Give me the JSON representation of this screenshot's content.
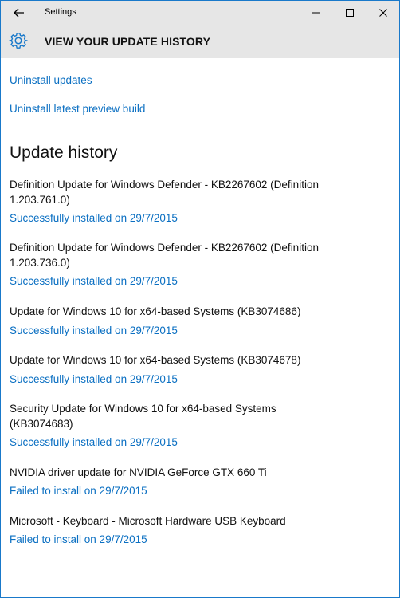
{
  "window": {
    "app_title": "Settings",
    "accent_color": "#1979ca",
    "controls": {
      "back": "back-arrow-icon",
      "minimize": "minimize-icon",
      "maximize": "maximize-icon",
      "close": "close-icon"
    }
  },
  "header": {
    "icon": "gear-icon",
    "title": "VIEW YOUR UPDATE HISTORY"
  },
  "links": {
    "uninstall_updates": "Uninstall updates",
    "uninstall_preview": "Uninstall latest preview build"
  },
  "history": {
    "title": "Update history",
    "entries": [
      {
        "title": "Definition Update for Windows Defender - KB2267602 (Definition 1.203.761.0)",
        "status": "Successfully installed on 29/7/2015"
      },
      {
        "title": "Definition Update for Windows Defender - KB2267602 (Definition 1.203.736.0)",
        "status": "Successfully installed on 29/7/2015"
      },
      {
        "title": "Update for Windows 10 for x64-based Systems (KB3074686)",
        "status": "Successfully installed on 29/7/2015"
      },
      {
        "title": "Update for Windows 10 for x64-based Systems (KB3074678)",
        "status": "Successfully installed on 29/7/2015"
      },
      {
        "title": "Security Update for Windows 10 for x64-based Systems (KB3074683)",
        "status": "Successfully installed on 29/7/2015"
      },
      {
        "title": "NVIDIA driver update for NVIDIA GeForce GTX 660 Ti",
        "status": "Failed to install on 29/7/2015"
      },
      {
        "title": "Microsoft - Keyboard - Microsoft Hardware USB Keyboard",
        "status": "Failed to install on 29/7/2015"
      }
    ]
  }
}
